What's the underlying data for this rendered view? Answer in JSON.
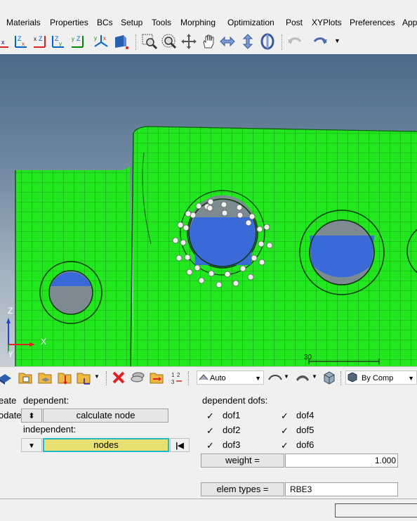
{
  "menu": {
    "items": [
      "Materials",
      "Properties",
      "BCs",
      "Setup",
      "Tools",
      "Morphing",
      "Optimization",
      "Post",
      "XYPlots",
      "Preferences",
      "App"
    ]
  },
  "toolbar": {
    "icons": [
      "view-x-icon",
      "view-zx-icon",
      "view-xz-icon",
      "view-zy-icon",
      "view-yz-icon",
      "view-iso-icon",
      "view-save-icon",
      "zoom-icon",
      "zoom-circle-icon",
      "rotate-icon",
      "pan-icon",
      "horizontal-arrows-icon",
      "vertical-arrows-icon",
      "spin-icon",
      "undo-icon",
      "redo-icon"
    ]
  },
  "viewport": {
    "triad": {
      "z_label": "Z",
      "x_label": "X",
      "y_label": "Y"
    },
    "scale_label": "30"
  },
  "panel_toolbar": {
    "auto_label": "Auto",
    "bycomp_label": "By Comp"
  },
  "panel": {
    "mode_create": "eate",
    "mode_update": "odate",
    "dependent_label": "dependent:",
    "calculate_node_label": "calculate node",
    "independent_label": "independent:",
    "nodes_label": "nodes",
    "dependent_dofs_label": "dependent dofs:",
    "dofs_left": [
      {
        "label": "dof1",
        "checked": true
      },
      {
        "label": "dof2",
        "checked": true
      },
      {
        "label": "dof3",
        "checked": true
      }
    ],
    "dofs_right": [
      {
        "label": "dof4",
        "checked": true
      },
      {
        "label": "dof5",
        "checked": true
      },
      {
        "label": "dof6",
        "checked": true
      }
    ],
    "weight_button": "weight =",
    "weight_value": "1.000",
    "elem_types_button": "elem types =",
    "elem_types_value": "RBE3"
  },
  "colors": {
    "mesh_green": "#22e61e",
    "hole_blue": "#3a6ad8",
    "nodes_field_yellow": "#e8e070",
    "nodes_field_border": "#20b8c8"
  }
}
